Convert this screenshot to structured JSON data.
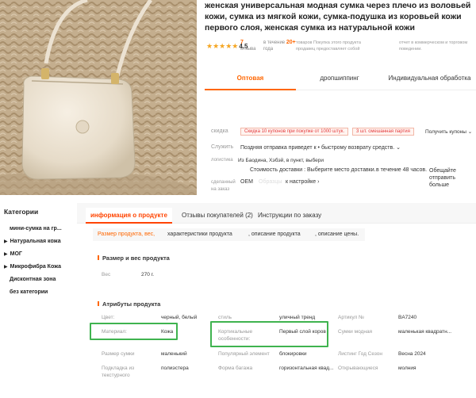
{
  "product": {
    "title": "женская универсальная модная сумка через плечо из воловьей кожи, сумка из мягкой кожи, сумка-подушка из коровьей кожи первого слоя, женская сумка из натуральной кожи",
    "rating": "4.5",
    "stars": "★★★★★",
    "reviews_count": "7",
    "reviews_label": "отзыва",
    "sold_prefix": "в течение",
    "sold_count": "20+",
    "sold_suffix": "года",
    "desc1": "товаров Покупка этого продукта продавец предоставляет собой",
    "desc2": "отчет в коммерческом и торговом поведении."
  },
  "tabs": {
    "wholesale": "Оптовая",
    "dropship": "дропшиппинг",
    "custom": "Индивидуальная обработка"
  },
  "info": {
    "discount_label": "скидка",
    "coupon1": "Скидка 10 купонов при покупке от 1000 штук.",
    "coupon2": "3 шт. смешанная партия",
    "get_coupons": "Получить купоны ⌄",
    "service_label": "Служить",
    "service_value": "Поздняя отправка приведет к • быстрому возврату средств. ⌄",
    "logistics_label": "логистика",
    "logistics_value": "Из Баодина, Хэбэй, в пункт, выбери",
    "shipping_cost": "Стоимость доставки : Выберите место доставки.",
    "shipping_time": "в течение 48 часов.",
    "shipping_note": "Обещайте отправить больше",
    "made_label": "сделанный на заказ",
    "made_value": "OEM",
    "made_faint": "Образцы",
    "settings": "к настройке ›"
  },
  "categories": {
    "title": "Категории",
    "items": [
      {
        "arrow": "",
        "label": "мини-сумка на гр..."
      },
      {
        "arrow": "▶",
        "label": "Натуральная кожа"
      },
      {
        "arrow": "▶",
        "label": "MOГ"
      },
      {
        "arrow": "▶",
        "label": "Микрофибра Кожа"
      },
      {
        "arrow": "",
        "label": "Дисконтная зона"
      },
      {
        "arrow": "",
        "label": "без категории"
      }
    ]
  },
  "detail_tabs": {
    "info": "информация о продукте",
    "reviews": "Отзывы покупателей (2)",
    "instructions": "Инструкции по заказу"
  },
  "sub_tabs": {
    "size": "Размер продукта, вес,",
    "chars": "характеристики продукта",
    "desc": ", описание продукта",
    "price": ", описание цены."
  },
  "size_section": {
    "title": "Размер и вес продукта",
    "weight_label": "Вес",
    "weight_value": "270 г."
  },
  "attributes": {
    "title": "Атрибуты продукта",
    "rows": [
      [
        "Цвет:",
        "черный, белый",
        "стиль",
        "уличный тренд",
        "Артикул №",
        "BA7240"
      ],
      [
        "Материал:",
        "Кожа",
        "Кортикальные особенности:",
        "Первый слой коров",
        "Сумки модная",
        "маленькая квадратн..."
      ],
      [
        "Размер сумки",
        "маленький",
        "Популярный элемент",
        "блокировки",
        "Листинг Год Сезон",
        "Весна 2024"
      ],
      [
        "Подкладка из текстурного",
        "полиэстера",
        "Форма багажа",
        "горизонтальная квад...",
        "Открывающиеся",
        "молния"
      ]
    ]
  },
  "colors": {
    "accent": "#ff6600",
    "highlight": "#3fb34f",
    "star": "#f5a623"
  }
}
